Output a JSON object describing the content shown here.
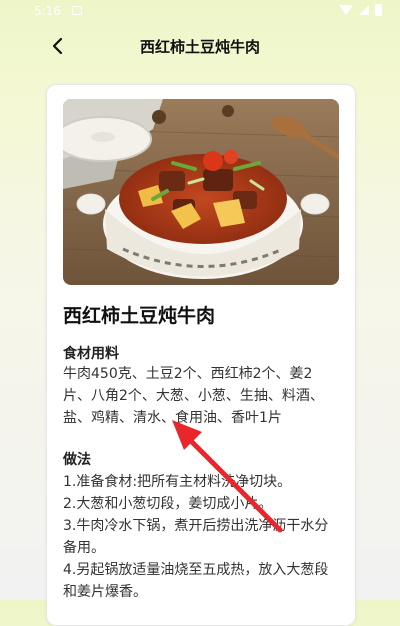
{
  "status_bar": {
    "time": "5:16"
  },
  "header": {
    "title": "西红柿土豆炖牛肉"
  },
  "recipe": {
    "name": "西红柿土豆炖牛肉",
    "ingredients_heading": "食材用料",
    "ingredients": "牛肉450克、土豆2个、西红柿2个、姜2片、八角2个、大葱、小葱、生抽、料酒、盐、鸡精、清水、食用油、香叶1片",
    "steps_heading": "做法",
    "steps": [
      "1.准备食材:把所有主材料洗净切块。",
      "2.大葱和小葱切段，姜切成小片。",
      "3.牛肉冷水下锅，煮开后捞出洗净沥干水分备用。",
      "4.另起锅放适量油烧至五成热，放入大葱段和姜片爆香。"
    ]
  },
  "colors": {
    "arrow": "#e8262b",
    "accent_bg": "#eef6c8"
  },
  "icons": {
    "back": "back-arrow-icon",
    "wifi": "wifi-icon",
    "signal": "signal-icon",
    "battery": "battery-icon"
  }
}
